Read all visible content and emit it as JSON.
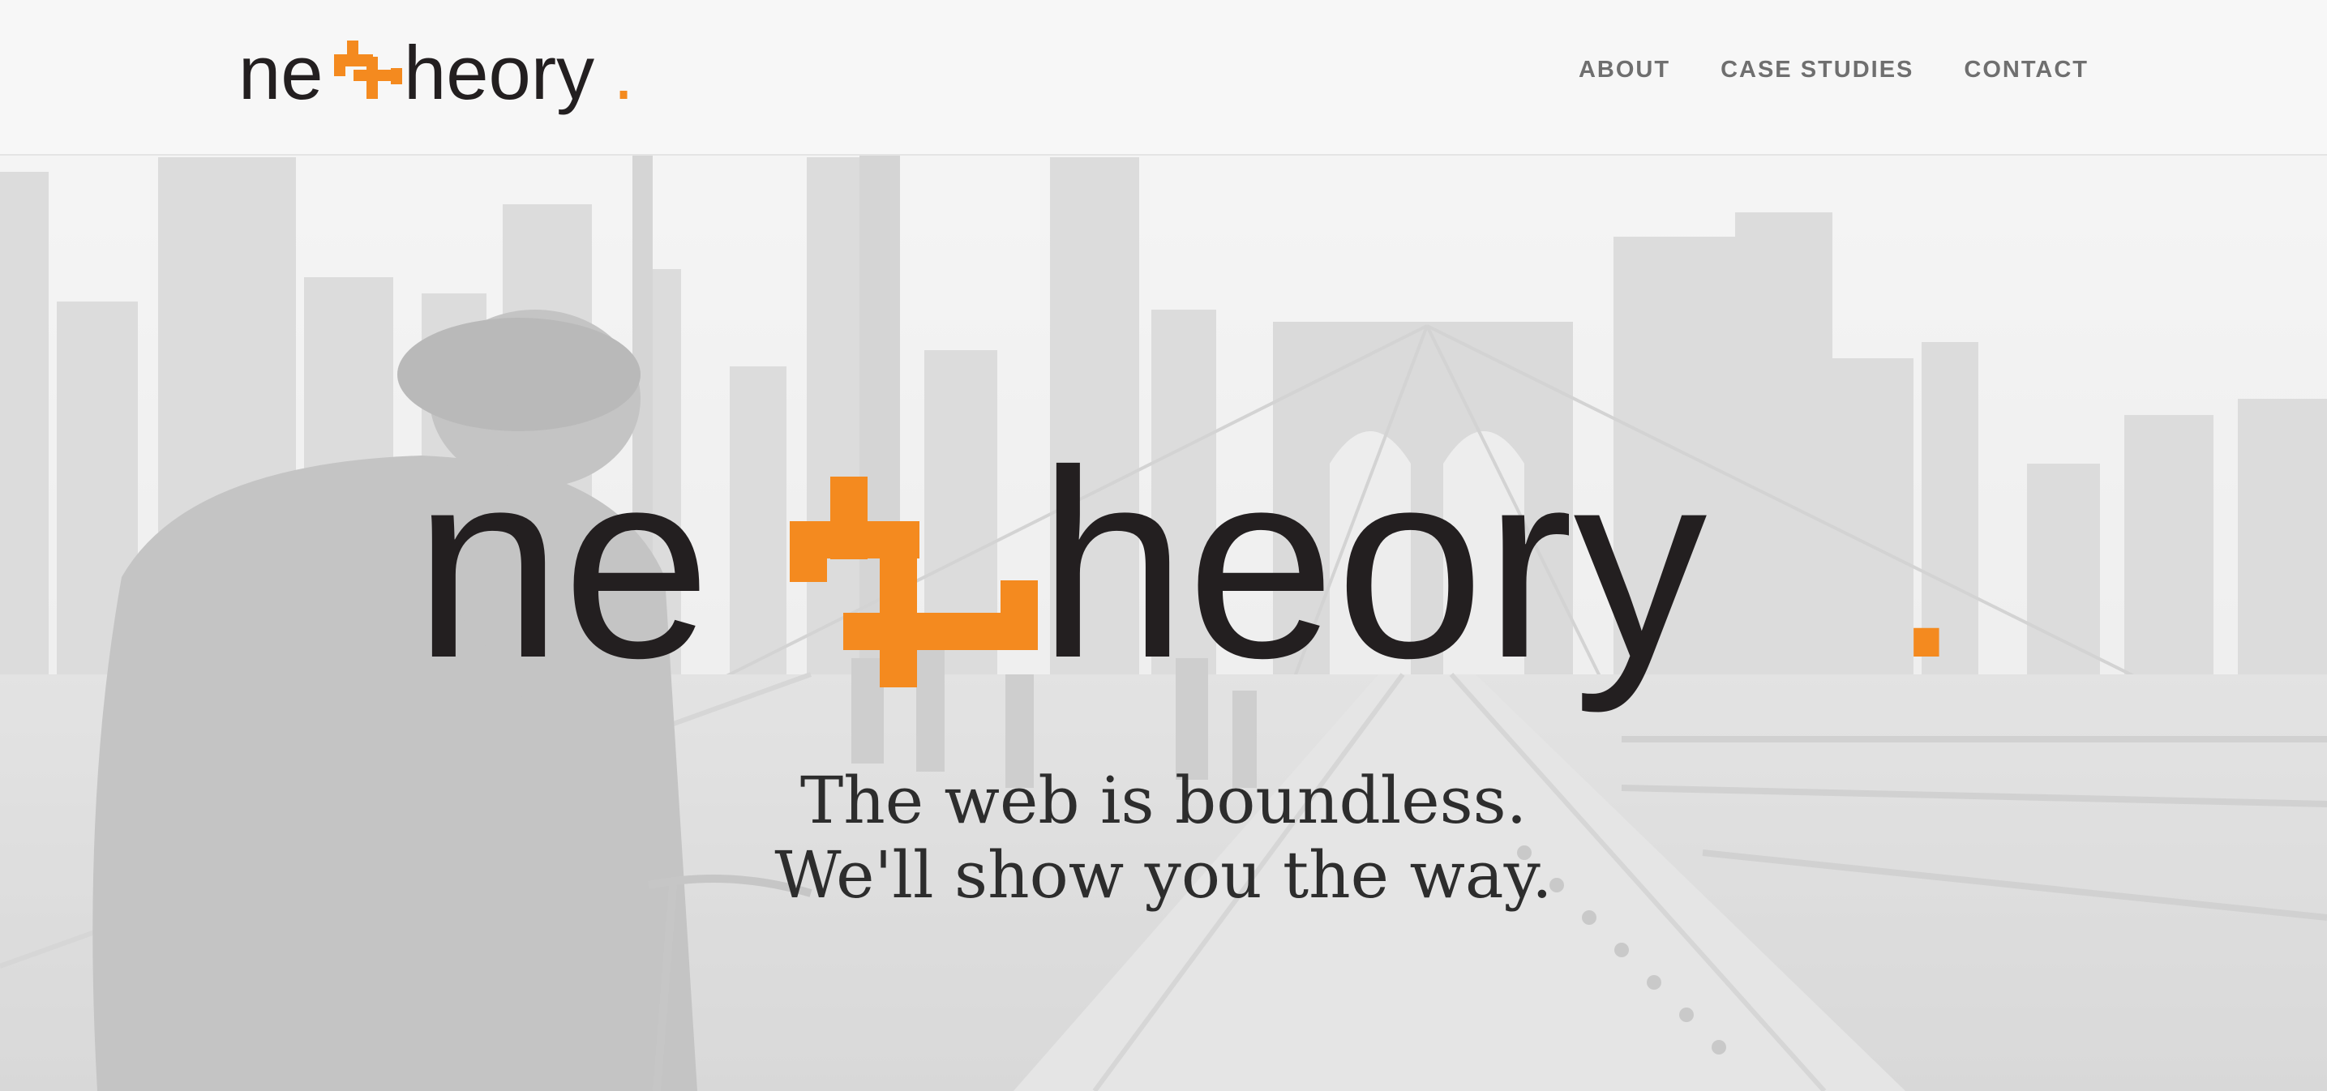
{
  "brand": {
    "logo_text_pre": "ne",
    "logo_text_post": "heory",
    "logo_dot": ".",
    "logo_alt": "nettheory.",
    "accent_color": "#f48a1f",
    "text_color": "#231f20"
  },
  "nav": {
    "items": [
      {
        "label": "ABOUT"
      },
      {
        "label": "CASE STUDIES"
      },
      {
        "label": "CONTACT"
      }
    ]
  },
  "hero": {
    "background_description_icon": "brooklyn-bridge-cyclist-photo",
    "tagline_line1": "The web is boundless.",
    "tagline_line2": "We'll show you the way."
  }
}
